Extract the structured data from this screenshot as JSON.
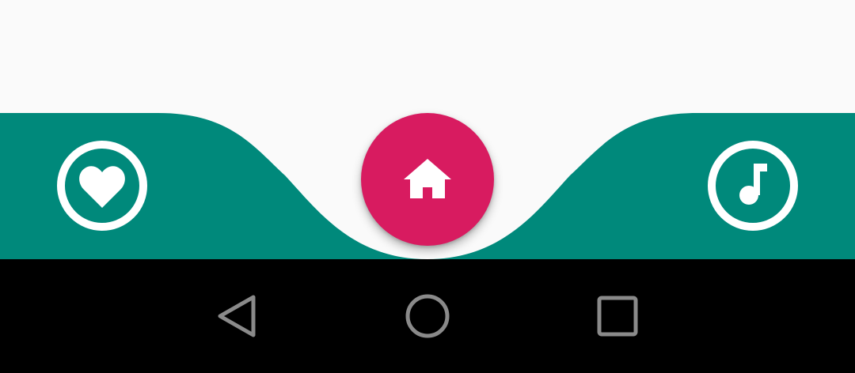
{
  "colors": {
    "background": "#fafafa",
    "nav_bar": "#00897b",
    "fab": "#d81b60",
    "icon": "#ffffff",
    "system_bar": "#000000",
    "system_icon": "#8a8a8a"
  },
  "bottom_nav": {
    "items": [
      {
        "icon": "heart-icon",
        "selected": false
      },
      {
        "icon": "home-icon",
        "selected": true
      },
      {
        "icon": "music-note-icon",
        "selected": false
      }
    ]
  },
  "system_nav": {
    "buttons": [
      {
        "icon": "back-triangle-icon"
      },
      {
        "icon": "home-circle-icon"
      },
      {
        "icon": "recents-square-icon"
      }
    ]
  }
}
